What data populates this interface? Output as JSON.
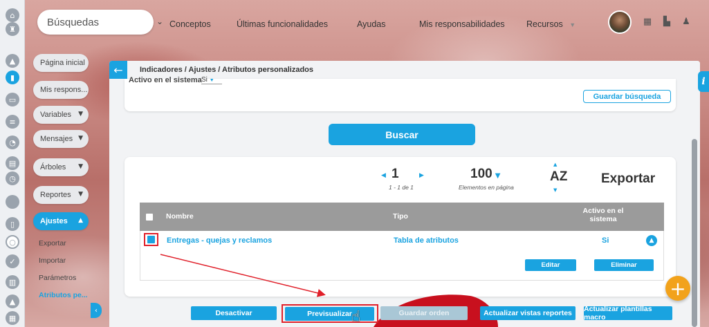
{
  "search": {
    "label": "Búsquedas"
  },
  "topnav": [
    "Conceptos",
    "Últimas funcionalidades",
    "Ayudas",
    "Mis responsabilidades",
    "Recursos"
  ],
  "sidebar": {
    "buttons": [
      "Página inicial",
      "Mis respons...",
      "Variables",
      "Mensajes",
      "Árboles",
      "Reportes",
      "Ajustes"
    ],
    "subitems": [
      "Exportar",
      "Importar",
      "Parámetros",
      "Atributos pe..."
    ]
  },
  "breadcrumb": "Indicadores / Ajustes / Atributos personalizados",
  "filter": {
    "label": "Activo en el sistema",
    "value": "Si"
  },
  "save_search_label": "Guardar búsqueda",
  "search_button_label": "Buscar",
  "pagination": {
    "page": "1",
    "range": "1 - 1 de 1",
    "per_page": "100",
    "per_page_label": "Elementos en página",
    "sort_label": "AZ",
    "export_label": "Exportar"
  },
  "table": {
    "headers": {
      "name": "Nombre",
      "type": "Tipo",
      "active": "Activo en el sistema"
    },
    "rows": [
      {
        "name": "Entregas - quejas y reclamos",
        "type": "Tabla de atributos",
        "active": "Si"
      }
    ],
    "row_actions": {
      "edit": "Editar",
      "delete": "Eliminar"
    }
  },
  "bottom_buttons": {
    "deactivate": "Desactivar",
    "preview": "Previsualizar",
    "save_order": "Guardar orden",
    "update_views": "Actualizar vistas reportes",
    "update_templates": "Actualizar plantillas macro"
  },
  "colors": {
    "accent": "#1aa3e0",
    "highlight": "#e0202a",
    "fab": "#f2a21b"
  }
}
